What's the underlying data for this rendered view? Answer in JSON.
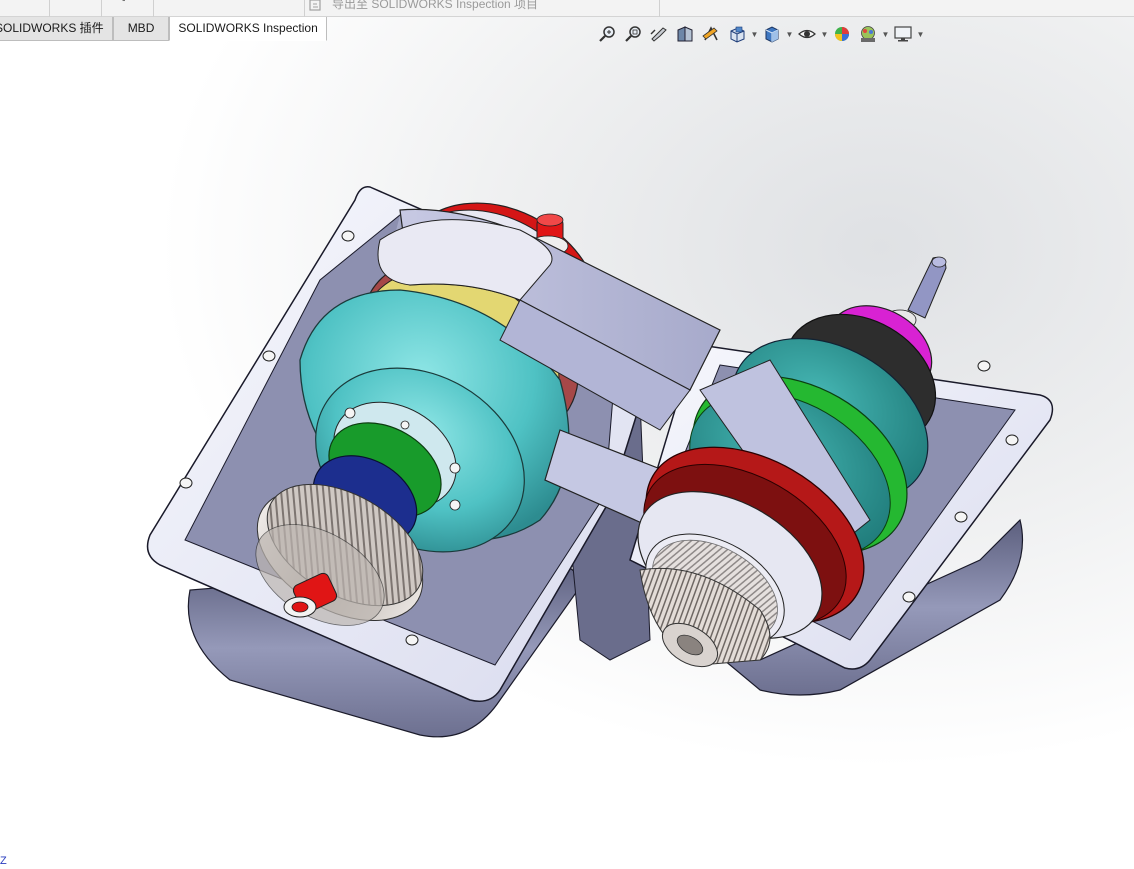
{
  "ribbon": {
    "hint_text": "导出至 SOLIDWORKS Inspection 项目"
  },
  "tabs": [
    {
      "label": "SOLIDWORKS 插件",
      "active": false
    },
    {
      "label": "MBD",
      "active": false
    },
    {
      "label": "SOLIDWORKS Inspection",
      "active": true
    }
  ],
  "heads_up_toolbar": {
    "icons": [
      "zoom-to-fit-icon",
      "zoom-to-area-icon",
      "previous-view-icon",
      "section-view-icon",
      "dynamic-annotation-icon",
      "view-orientation-icon",
      "display-style-icon",
      "hide-show-items-icon",
      "edit-appearance-icon",
      "apply-scene-icon",
      "view-settings-icon"
    ]
  },
  "viewport": {
    "axis_label": "Z",
    "background_colors": [
      "#dfe1e4",
      "#ffffff"
    ]
  },
  "model": {
    "colors": {
      "housing": "#f4f5fb",
      "housing_shadow": "#8f93b3",
      "belt": "#b9bcd9",
      "teal_pulley": "#56c9c9",
      "yellow_disc": "#e5da78",
      "maroon_disc": "#a54545",
      "green_ring": "#179a2b",
      "navy_ring": "#1b2d8f",
      "red_cap": "#e01515",
      "magenta_cap": "#d820d2",
      "black_ring": "#2b2b2b",
      "shaft": "#9296c4",
      "gear": "#c9c2be"
    }
  }
}
